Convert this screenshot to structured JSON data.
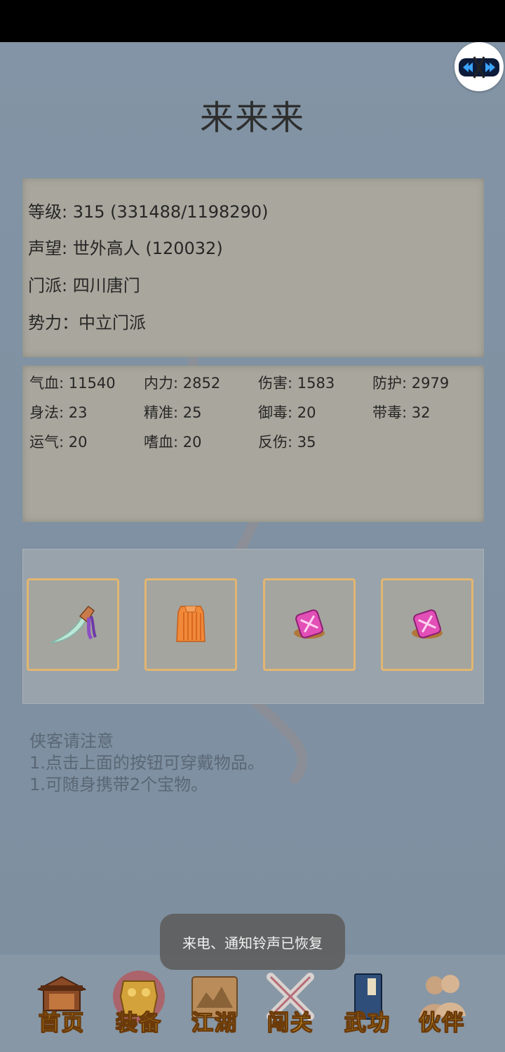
{
  "character": {
    "name": "来来来"
  },
  "info": {
    "level": "等级: 315 (331488/1198290)",
    "reputation": "声望: 世外高人 (120032)",
    "sect": "门派: 四川唐门",
    "faction": "势力：中立门派"
  },
  "stats": [
    "气血: 11540",
    "内力: 2852",
    "伤害: 1583",
    "防护: 2979",
    "身法: 23",
    "精准: 25",
    "御毒: 20",
    "带毒: 32",
    "运气: 20",
    "嗜血: 20",
    "反伤: 35"
  ],
  "equipment": [
    {
      "icon": "dagger-icon"
    },
    {
      "icon": "orange-robe-icon"
    },
    {
      "icon": "pink-treasure-icon"
    },
    {
      "icon": "pink-treasure-icon"
    }
  ],
  "notice": {
    "title": "侠客请注意",
    "line1": "1.点击上面的按钮可穿戴物品。",
    "line2": "1.可随身携带2个宝物。"
  },
  "toast": "来电、通知铃声已恢复",
  "nav": [
    {
      "label": "首页",
      "icon": "house-icon"
    },
    {
      "label": "装备",
      "icon": "armor-icon"
    },
    {
      "label": "江湖",
      "icon": "scroll-map-icon"
    },
    {
      "label": "闯关",
      "icon": "crossed-swords-icon"
    },
    {
      "label": "武功",
      "icon": "book-icon"
    },
    {
      "label": "伙伴",
      "icon": "partners-icon"
    }
  ],
  "colors": {
    "label_gold": "#f3c82c",
    "slot_border": "#e2b671",
    "background": "#7e8fa0"
  }
}
